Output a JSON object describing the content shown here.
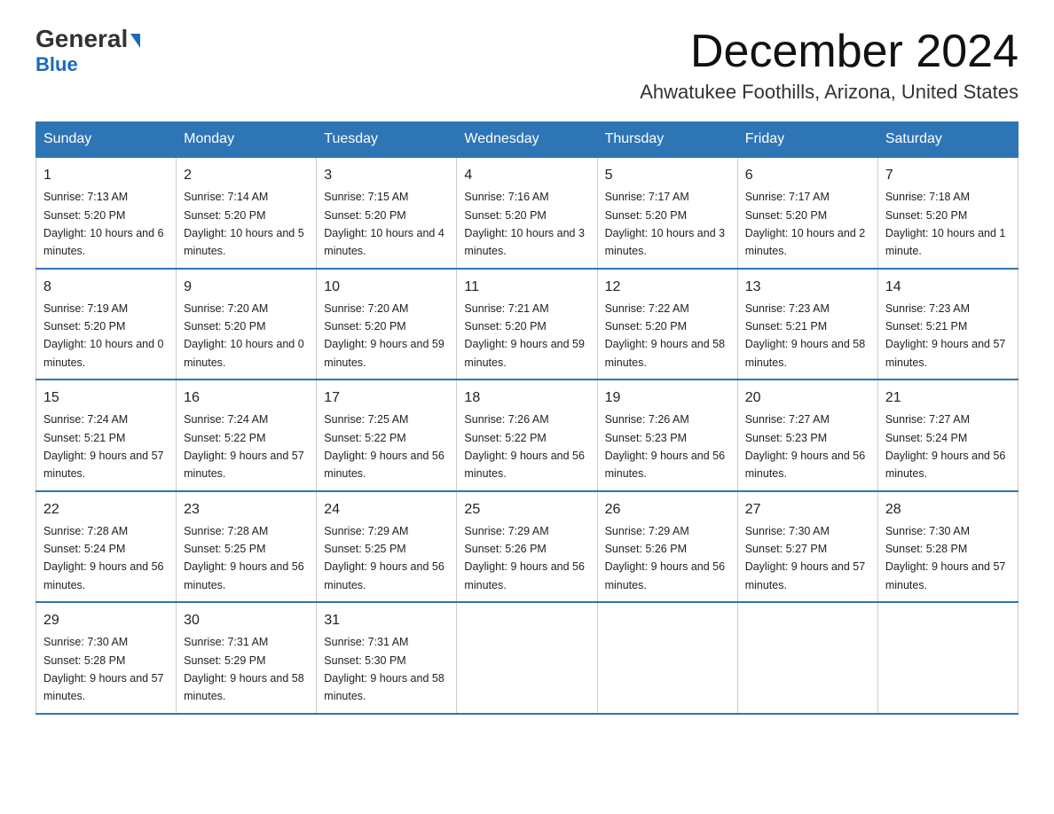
{
  "header": {
    "logo_line1": "General",
    "logo_line2": "Blue",
    "month_title": "December 2024",
    "location": "Ahwatukee Foothills, Arizona, United States"
  },
  "weekdays": [
    "Sunday",
    "Monday",
    "Tuesday",
    "Wednesday",
    "Thursday",
    "Friday",
    "Saturday"
  ],
  "weeks": [
    [
      {
        "day": "1",
        "sunrise": "7:13 AM",
        "sunset": "5:20 PM",
        "daylight": "10 hours and 6 minutes."
      },
      {
        "day": "2",
        "sunrise": "7:14 AM",
        "sunset": "5:20 PM",
        "daylight": "10 hours and 5 minutes."
      },
      {
        "day": "3",
        "sunrise": "7:15 AM",
        "sunset": "5:20 PM",
        "daylight": "10 hours and 4 minutes."
      },
      {
        "day": "4",
        "sunrise": "7:16 AM",
        "sunset": "5:20 PM",
        "daylight": "10 hours and 3 minutes."
      },
      {
        "day": "5",
        "sunrise": "7:17 AM",
        "sunset": "5:20 PM",
        "daylight": "10 hours and 3 minutes."
      },
      {
        "day": "6",
        "sunrise": "7:17 AM",
        "sunset": "5:20 PM",
        "daylight": "10 hours and 2 minutes."
      },
      {
        "day": "7",
        "sunrise": "7:18 AM",
        "sunset": "5:20 PM",
        "daylight": "10 hours and 1 minute."
      }
    ],
    [
      {
        "day": "8",
        "sunrise": "7:19 AM",
        "sunset": "5:20 PM",
        "daylight": "10 hours and 0 minutes."
      },
      {
        "day": "9",
        "sunrise": "7:20 AM",
        "sunset": "5:20 PM",
        "daylight": "10 hours and 0 minutes."
      },
      {
        "day": "10",
        "sunrise": "7:20 AM",
        "sunset": "5:20 PM",
        "daylight": "9 hours and 59 minutes."
      },
      {
        "day": "11",
        "sunrise": "7:21 AM",
        "sunset": "5:20 PM",
        "daylight": "9 hours and 59 minutes."
      },
      {
        "day": "12",
        "sunrise": "7:22 AM",
        "sunset": "5:20 PM",
        "daylight": "9 hours and 58 minutes."
      },
      {
        "day": "13",
        "sunrise": "7:23 AM",
        "sunset": "5:21 PM",
        "daylight": "9 hours and 58 minutes."
      },
      {
        "day": "14",
        "sunrise": "7:23 AM",
        "sunset": "5:21 PM",
        "daylight": "9 hours and 57 minutes."
      }
    ],
    [
      {
        "day": "15",
        "sunrise": "7:24 AM",
        "sunset": "5:21 PM",
        "daylight": "9 hours and 57 minutes."
      },
      {
        "day": "16",
        "sunrise": "7:24 AM",
        "sunset": "5:22 PM",
        "daylight": "9 hours and 57 minutes."
      },
      {
        "day": "17",
        "sunrise": "7:25 AM",
        "sunset": "5:22 PM",
        "daylight": "9 hours and 56 minutes."
      },
      {
        "day": "18",
        "sunrise": "7:26 AM",
        "sunset": "5:22 PM",
        "daylight": "9 hours and 56 minutes."
      },
      {
        "day": "19",
        "sunrise": "7:26 AM",
        "sunset": "5:23 PM",
        "daylight": "9 hours and 56 minutes."
      },
      {
        "day": "20",
        "sunrise": "7:27 AM",
        "sunset": "5:23 PM",
        "daylight": "9 hours and 56 minutes."
      },
      {
        "day": "21",
        "sunrise": "7:27 AM",
        "sunset": "5:24 PM",
        "daylight": "9 hours and 56 minutes."
      }
    ],
    [
      {
        "day": "22",
        "sunrise": "7:28 AM",
        "sunset": "5:24 PM",
        "daylight": "9 hours and 56 minutes."
      },
      {
        "day": "23",
        "sunrise": "7:28 AM",
        "sunset": "5:25 PM",
        "daylight": "9 hours and 56 minutes."
      },
      {
        "day": "24",
        "sunrise": "7:29 AM",
        "sunset": "5:25 PM",
        "daylight": "9 hours and 56 minutes."
      },
      {
        "day": "25",
        "sunrise": "7:29 AM",
        "sunset": "5:26 PM",
        "daylight": "9 hours and 56 minutes."
      },
      {
        "day": "26",
        "sunrise": "7:29 AM",
        "sunset": "5:26 PM",
        "daylight": "9 hours and 56 minutes."
      },
      {
        "day": "27",
        "sunrise": "7:30 AM",
        "sunset": "5:27 PM",
        "daylight": "9 hours and 57 minutes."
      },
      {
        "day": "28",
        "sunrise": "7:30 AM",
        "sunset": "5:28 PM",
        "daylight": "9 hours and 57 minutes."
      }
    ],
    [
      {
        "day": "29",
        "sunrise": "7:30 AM",
        "sunset": "5:28 PM",
        "daylight": "9 hours and 57 minutes."
      },
      {
        "day": "30",
        "sunrise": "7:31 AM",
        "sunset": "5:29 PM",
        "daylight": "9 hours and 58 minutes."
      },
      {
        "day": "31",
        "sunrise": "7:31 AM",
        "sunset": "5:30 PM",
        "daylight": "9 hours and 58 minutes."
      },
      null,
      null,
      null,
      null
    ]
  ],
  "labels": {
    "sunrise": "Sunrise: ",
    "sunset": "Sunset: ",
    "daylight": "Daylight: "
  }
}
